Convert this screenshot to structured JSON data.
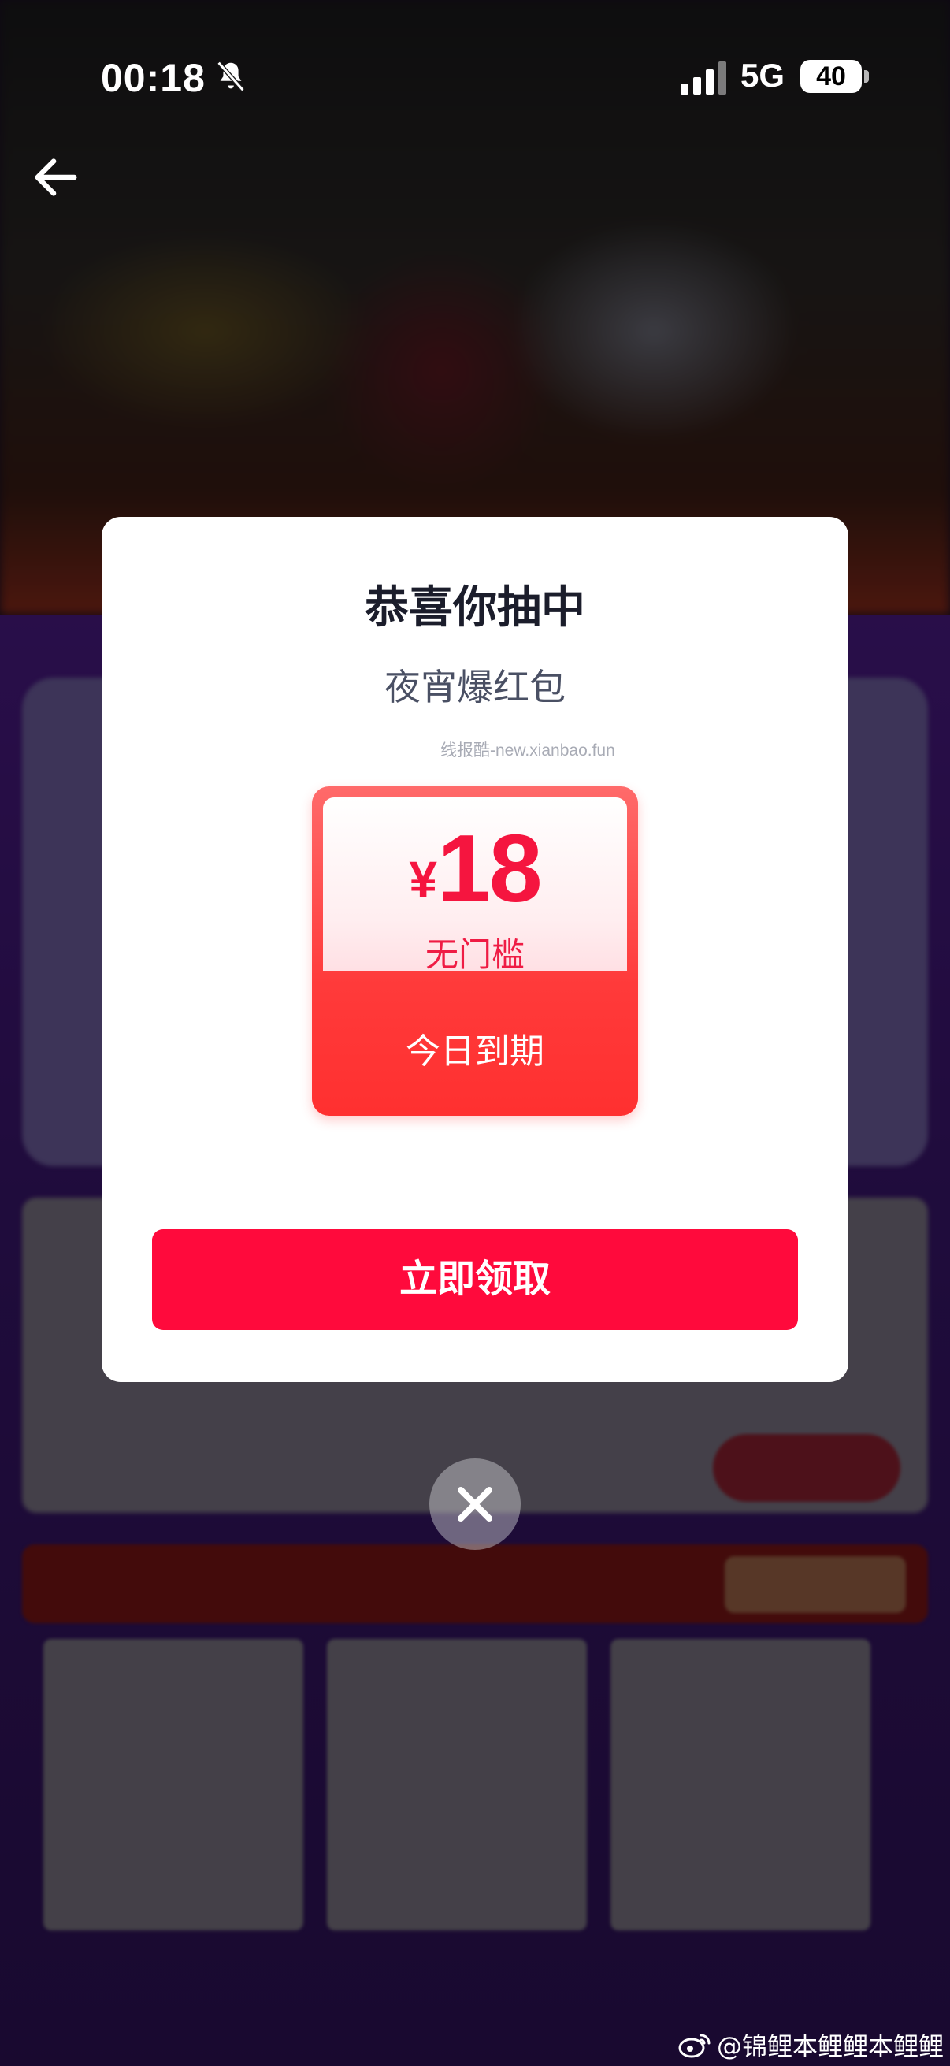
{
  "status_bar": {
    "time": "00:18",
    "network": "5G",
    "battery": "40"
  },
  "modal": {
    "title": "恭喜你抽中",
    "subtitle": "夜宵爆红包",
    "watermark": "线报酷-new.xianbao.fun",
    "coupon": {
      "currency": "¥",
      "amount": "18",
      "condition": "无门槛",
      "expiry": "今日到期"
    },
    "claim_button": "立即领取"
  },
  "footer": {
    "weibo_handle": "@锦鲤本鲤鲤本鲤鲤"
  },
  "colors": {
    "accent": "#ff0a3c",
    "coupon_red": "#ff3a3a",
    "title_text": "#1b1d2b"
  },
  "icons": [
    "back-arrow-icon",
    "mute-bell-icon",
    "signal-icon",
    "close-icon",
    "weibo-icon"
  ]
}
